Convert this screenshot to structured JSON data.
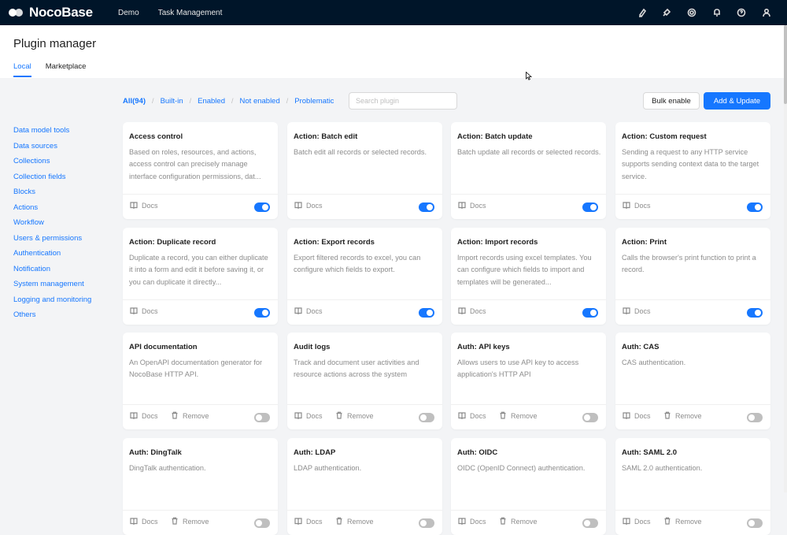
{
  "app": {
    "logo_text": "NocoBase"
  },
  "topnav": [
    "Demo",
    "Task Management"
  ],
  "topicons": [
    "highlighter-icon",
    "plugin-icon",
    "gear-icon",
    "bell-icon",
    "help-icon",
    "user-icon"
  ],
  "page": {
    "title": "Plugin manager",
    "tabs": [
      "Local",
      "Marketplace"
    ],
    "active_tab": "Local"
  },
  "filters": [
    "All(94)",
    "Built-in",
    "Enabled",
    "Not enabled",
    "Problematic"
  ],
  "search": {
    "placeholder": "Search plugin"
  },
  "buttons": {
    "bulk_enable": "Bulk enable",
    "add_update": "Add & Update"
  },
  "categories": [
    "Data model tools",
    "Data sources",
    "Collections",
    "Collection fields",
    "Blocks",
    "Actions",
    "Workflow",
    "Users & permissions",
    "Authentication",
    "Notification",
    "System management",
    "Logging and monitoring",
    "Others"
  ],
  "labels": {
    "docs": "Docs",
    "remove": "Remove"
  },
  "colors": {
    "primary": "#1677ff",
    "topbar": "#001529"
  },
  "plugins": [
    {
      "title": "Access control",
      "desc": "Based on roles, resources, and actions, access control can precisely manage interface configuration permissions, dat...",
      "enabled": true,
      "removable": false
    },
    {
      "title": "Action: Batch edit",
      "desc": "Batch edit all records or selected records.",
      "enabled": true,
      "removable": false
    },
    {
      "title": "Action: Batch update",
      "desc": "Batch update all records or selected records.",
      "enabled": true,
      "removable": false
    },
    {
      "title": "Action: Custom request",
      "desc": "Sending a request to any HTTP service supports sending context data to the target service.",
      "enabled": true,
      "removable": false
    },
    {
      "title": "Action: Duplicate record",
      "desc": "Duplicate a record, you can either duplicate it into a form and edit it before saving it, or you can duplicate it directly...",
      "enabled": true,
      "removable": false
    },
    {
      "title": "Action: Export records",
      "desc": "Export filtered records to excel, you can configure which fields to export.",
      "enabled": true,
      "removable": false
    },
    {
      "title": "Action: Import records",
      "desc": "Import records using excel templates. You can configure which fields to import and templates will be generated...",
      "enabled": true,
      "removable": false
    },
    {
      "title": "Action: Print",
      "desc": "Calls the browser's print function to print a record.",
      "enabled": true,
      "removable": false
    },
    {
      "title": "API documentation",
      "desc": "An OpenAPI documentation generator for NocoBase HTTP API.",
      "enabled": false,
      "removable": true
    },
    {
      "title": "Audit logs",
      "desc": "Track and document user activities and resource actions across the system",
      "enabled": false,
      "removable": true
    },
    {
      "title": "Auth: API keys",
      "desc": "Allows users to use API key to access application's HTTP API",
      "enabled": false,
      "removable": true
    },
    {
      "title": "Auth: CAS",
      "desc": "CAS authentication.",
      "enabled": false,
      "removable": true
    },
    {
      "title": "Auth: DingTalk",
      "desc": "DingTalk authentication.",
      "enabled": false,
      "removable": true
    },
    {
      "title": "Auth: LDAP",
      "desc": "LDAP authentication.",
      "enabled": false,
      "removable": true
    },
    {
      "title": "Auth: OIDC",
      "desc": "OIDC (OpenID Connect) authentication.",
      "enabled": false,
      "removable": true
    },
    {
      "title": "Auth: SAML 2.0",
      "desc": "SAML 2.0 authentication.",
      "enabled": false,
      "removable": true
    }
  ]
}
